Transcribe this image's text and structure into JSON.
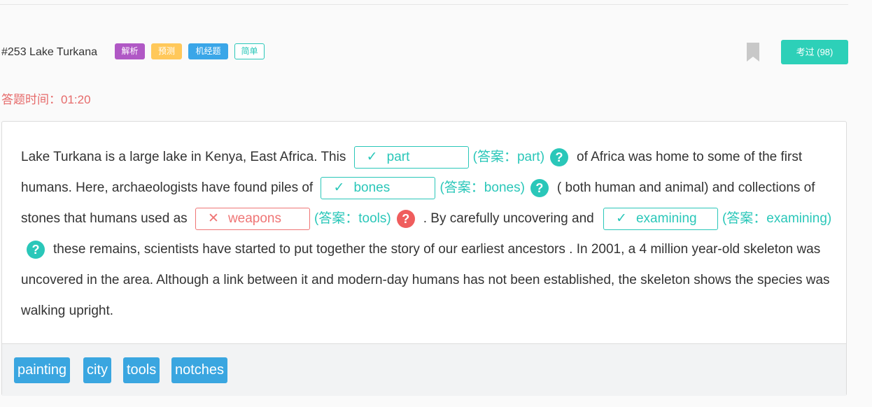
{
  "header": {
    "title": "#253 Lake Turkana",
    "tags": [
      "解析",
      "预测",
      "机经题",
      "简单"
    ],
    "bookmark_icon": "bookmark-icon",
    "kaoguo_label": "考过 (98)"
  },
  "timer": "答题时间：01:20",
  "passage": {
    "s1": "Lake Turkana is a large lake in Kenya, East Africa. This",
    "b1": {
      "mark": "✓",
      "value": "part",
      "answer": "(答案：part)",
      "correct": true
    },
    "s2": "of Africa was home to some of the first humans. Here, archaeologists have found piles of",
    "b2": {
      "mark": "✓",
      "value": "bones",
      "answer": "(答案：bones)",
      "correct": true
    },
    "s3": "( both human and animal) and collections of stones that humans used as",
    "b3": {
      "mark": "✕",
      "value": "weapons",
      "answer": "(答案：tools)",
      "correct": false
    },
    "s4": ". By carefully uncovering and",
    "b4": {
      "mark": "✓",
      "value": "examining",
      "answer": "(答案：examining)",
      "correct": true
    },
    "s5": "these remains, scientists have started to put together the story of our earliest ancestors . In 2001, a 4 million year-old skeleton was uncovered in the area. Although a link between it and modern-day humans has not been established, the skeleton shows the species was walking upright.",
    "help_glyph": "?"
  },
  "options": [
    "painting",
    "city",
    "tools",
    "notches"
  ],
  "colors": {
    "accent": "#2ac7b9",
    "wrong": "#ef5d5d",
    "timer": "#e66a6a",
    "option_bg": "#3aa6e0"
  }
}
